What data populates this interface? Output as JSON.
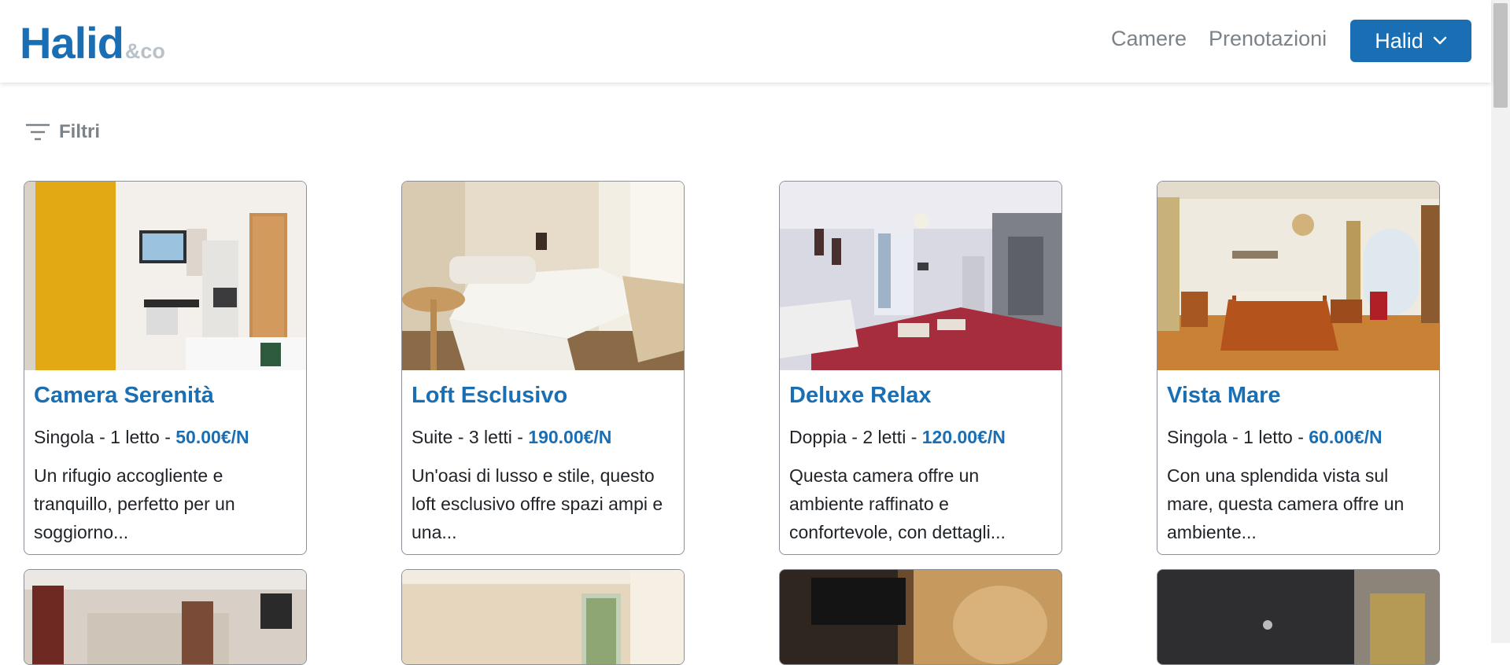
{
  "header": {
    "logo_main": "Halid",
    "logo_sub": "&co",
    "nav": [
      "Camere",
      "Prenotazioni"
    ],
    "user_button": "Halid"
  },
  "filters": {
    "label": "Filtri"
  },
  "rooms": [
    {
      "title": "Camera Serenità",
      "meta": "Singola - 1 letto - ",
      "price": "50.00€/N",
      "desc": "Un rifugio accogliente e tranquillo, perfetto per un soggiorno..."
    },
    {
      "title": "Loft Esclusivo",
      "meta": "Suite - 3 letti - ",
      "price": "190.00€/N",
      "desc": "Un'oasi di lusso e stile, questo loft esclusivo offre spazi ampi e una..."
    },
    {
      "title": "Deluxe Relax",
      "meta": "Doppia - 2 letti - ",
      "price": "120.00€/N",
      "desc": "Questa camera offre un ambiente raffinato e confortevole, con dettagli..."
    },
    {
      "title": "Vista Mare",
      "meta": "Singola - 1 letto - ",
      "price": "60.00€/N",
      "desc": "Con una splendida vista sul mare, questa camera offre un ambiente..."
    }
  ],
  "colors": {
    "accent": "#1a6fb4",
    "muted": "#7b8288",
    "logo_sub": "#b9c1c9"
  },
  "icons": {
    "filters": "filter-lines-icon",
    "dropdown": "chevron-down-icon"
  }
}
